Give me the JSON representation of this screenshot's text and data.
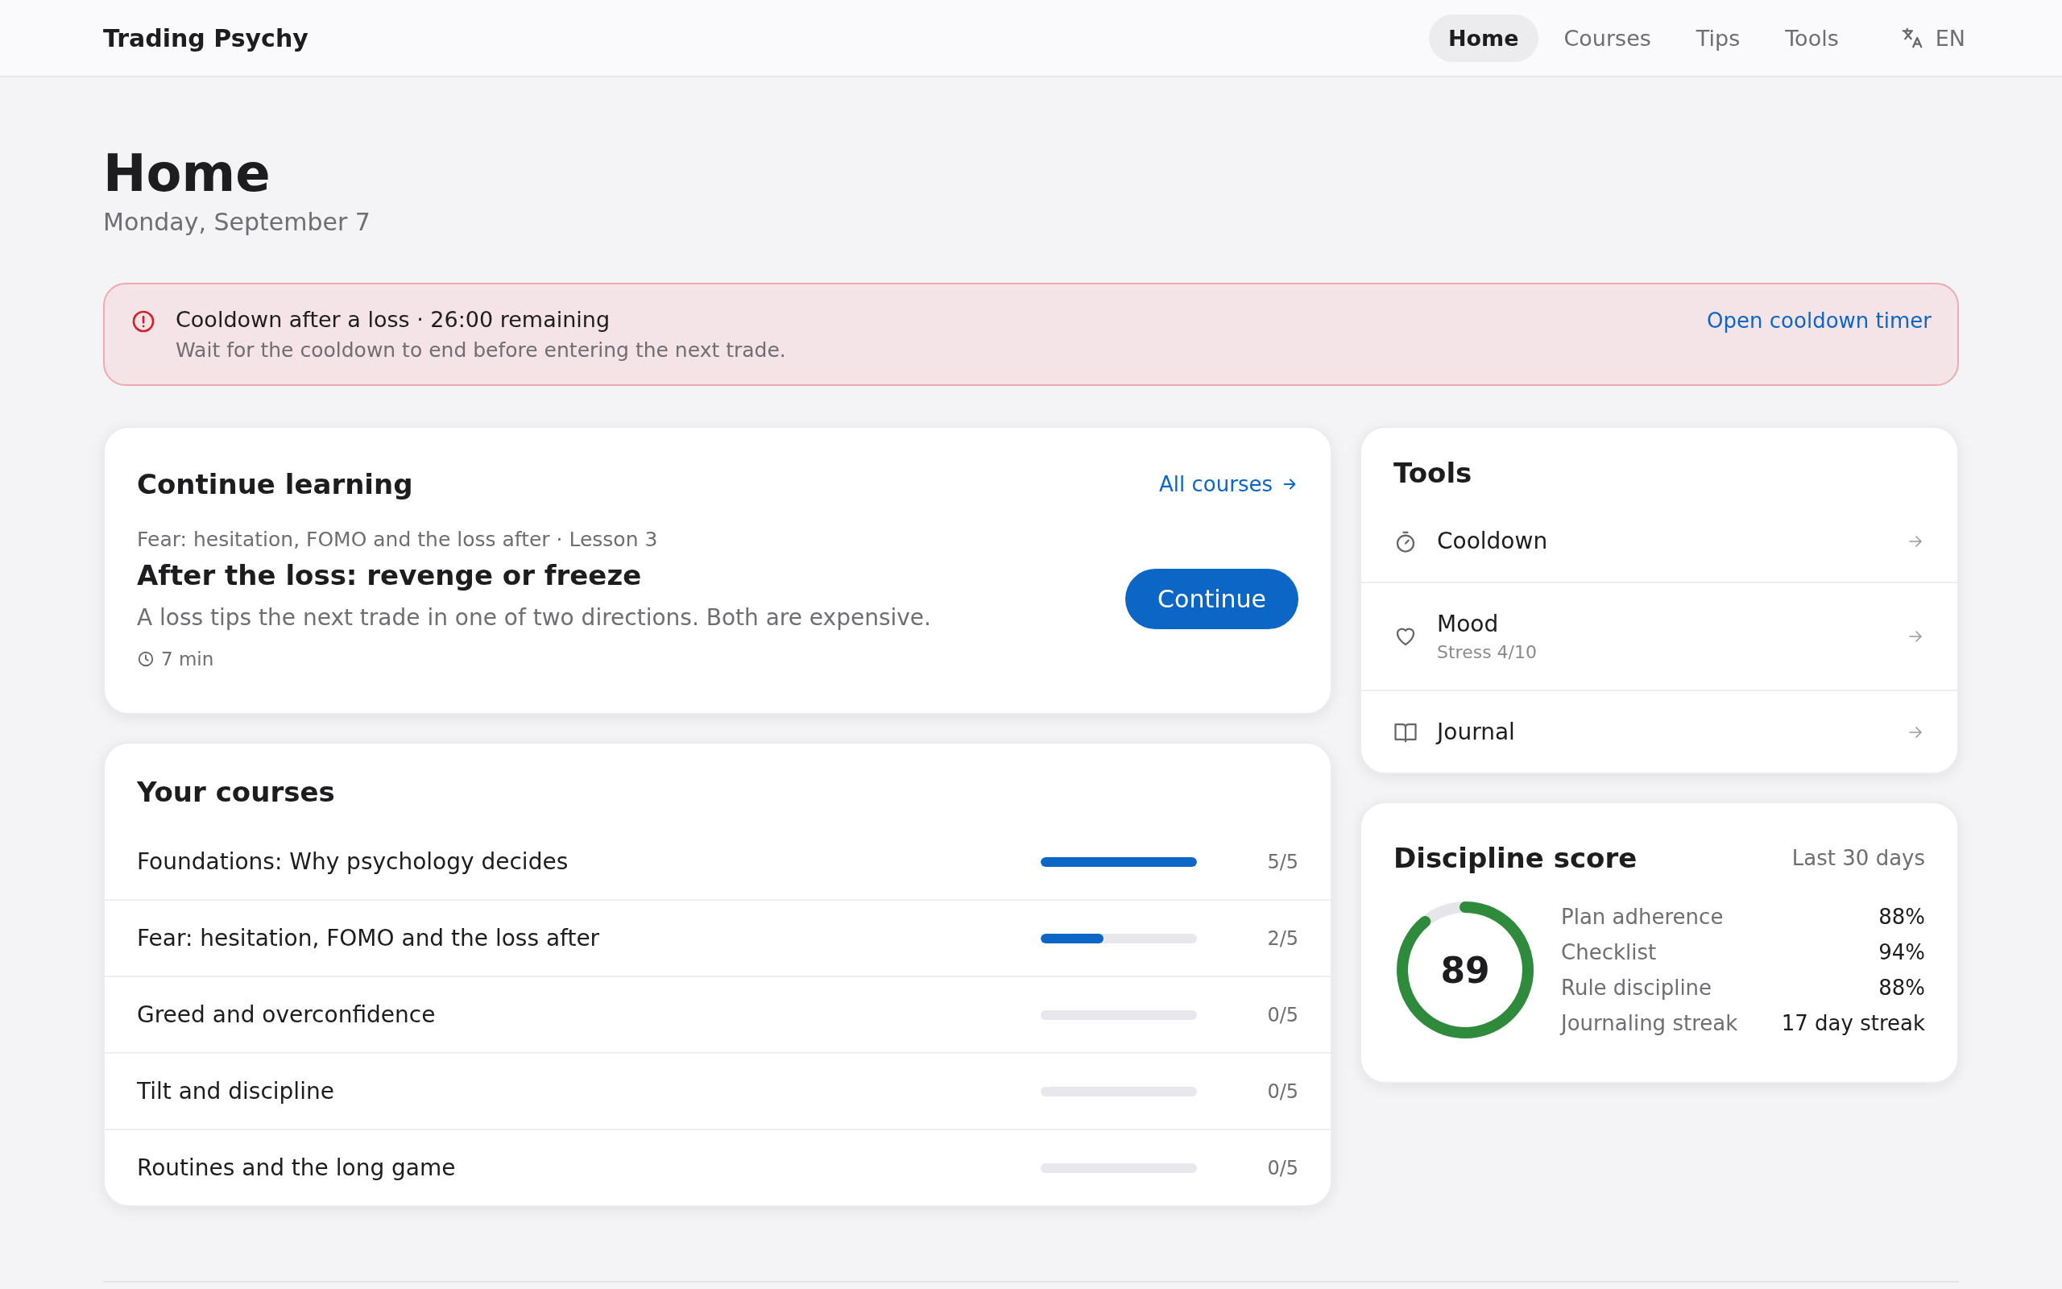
{
  "app": {
    "name": "Trading Psychy"
  },
  "nav": {
    "tabs": [
      {
        "label": "Home",
        "selected": true
      },
      {
        "label": "Courses",
        "selected": false
      },
      {
        "label": "Tips",
        "selected": false
      },
      {
        "label": "Tools",
        "selected": false
      }
    ],
    "language": "EN"
  },
  "page": {
    "title": "Home",
    "date": "Monday, September 7"
  },
  "alert": {
    "title": "Cooldown after a loss · 26:00 remaining",
    "message": "Wait for the cooldown to end before entering the next trade.",
    "link": "Open cooldown timer"
  },
  "continue_learning": {
    "title": "Continue learning",
    "link": "All courses",
    "course": "Fear: hesitation, FOMO and the loss after · Lesson 3",
    "lesson": "After the loss: revenge or freeze",
    "summary": "A loss tips the next trade in one of two directions. Both are expensive.",
    "duration": "7 min",
    "button": "Continue"
  },
  "your_courses": {
    "title": "Your courses",
    "rows": [
      {
        "name": "Foundations: Why psychology decides",
        "level": 1,
        "progress": "5/5"
      },
      {
        "name": "Fear: hesitation, FOMO and the loss after",
        "level": 0.4,
        "progress": "2/5"
      },
      {
        "name": "Greed and overconfidence",
        "level": 0,
        "progress": "0/5"
      },
      {
        "name": "Tilt and discipline",
        "level": 0,
        "progress": "0/5"
      },
      {
        "name": "Routines and the long game",
        "level": 0,
        "progress": "0/5"
      }
    ]
  },
  "tools": {
    "title": "Tools",
    "items": [
      {
        "kind": "timer",
        "label": "Cooldown"
      },
      {
        "kind": "mood",
        "label": "Mood",
        "detail": "Stress 4/10"
      },
      {
        "kind": "journal",
        "label": "Journal"
      }
    ]
  },
  "discipline": {
    "title": "Discipline score",
    "period": "Last 30 days",
    "score": "89",
    "metrics": [
      {
        "label": "Plan adherence",
        "value": "88%"
      },
      {
        "label": "Checklist",
        "value": "94%"
      },
      {
        "label": "Rule discipline",
        "value": "88%"
      },
      {
        "label": "Journaling streak",
        "value": "17 day streak"
      }
    ]
  }
}
